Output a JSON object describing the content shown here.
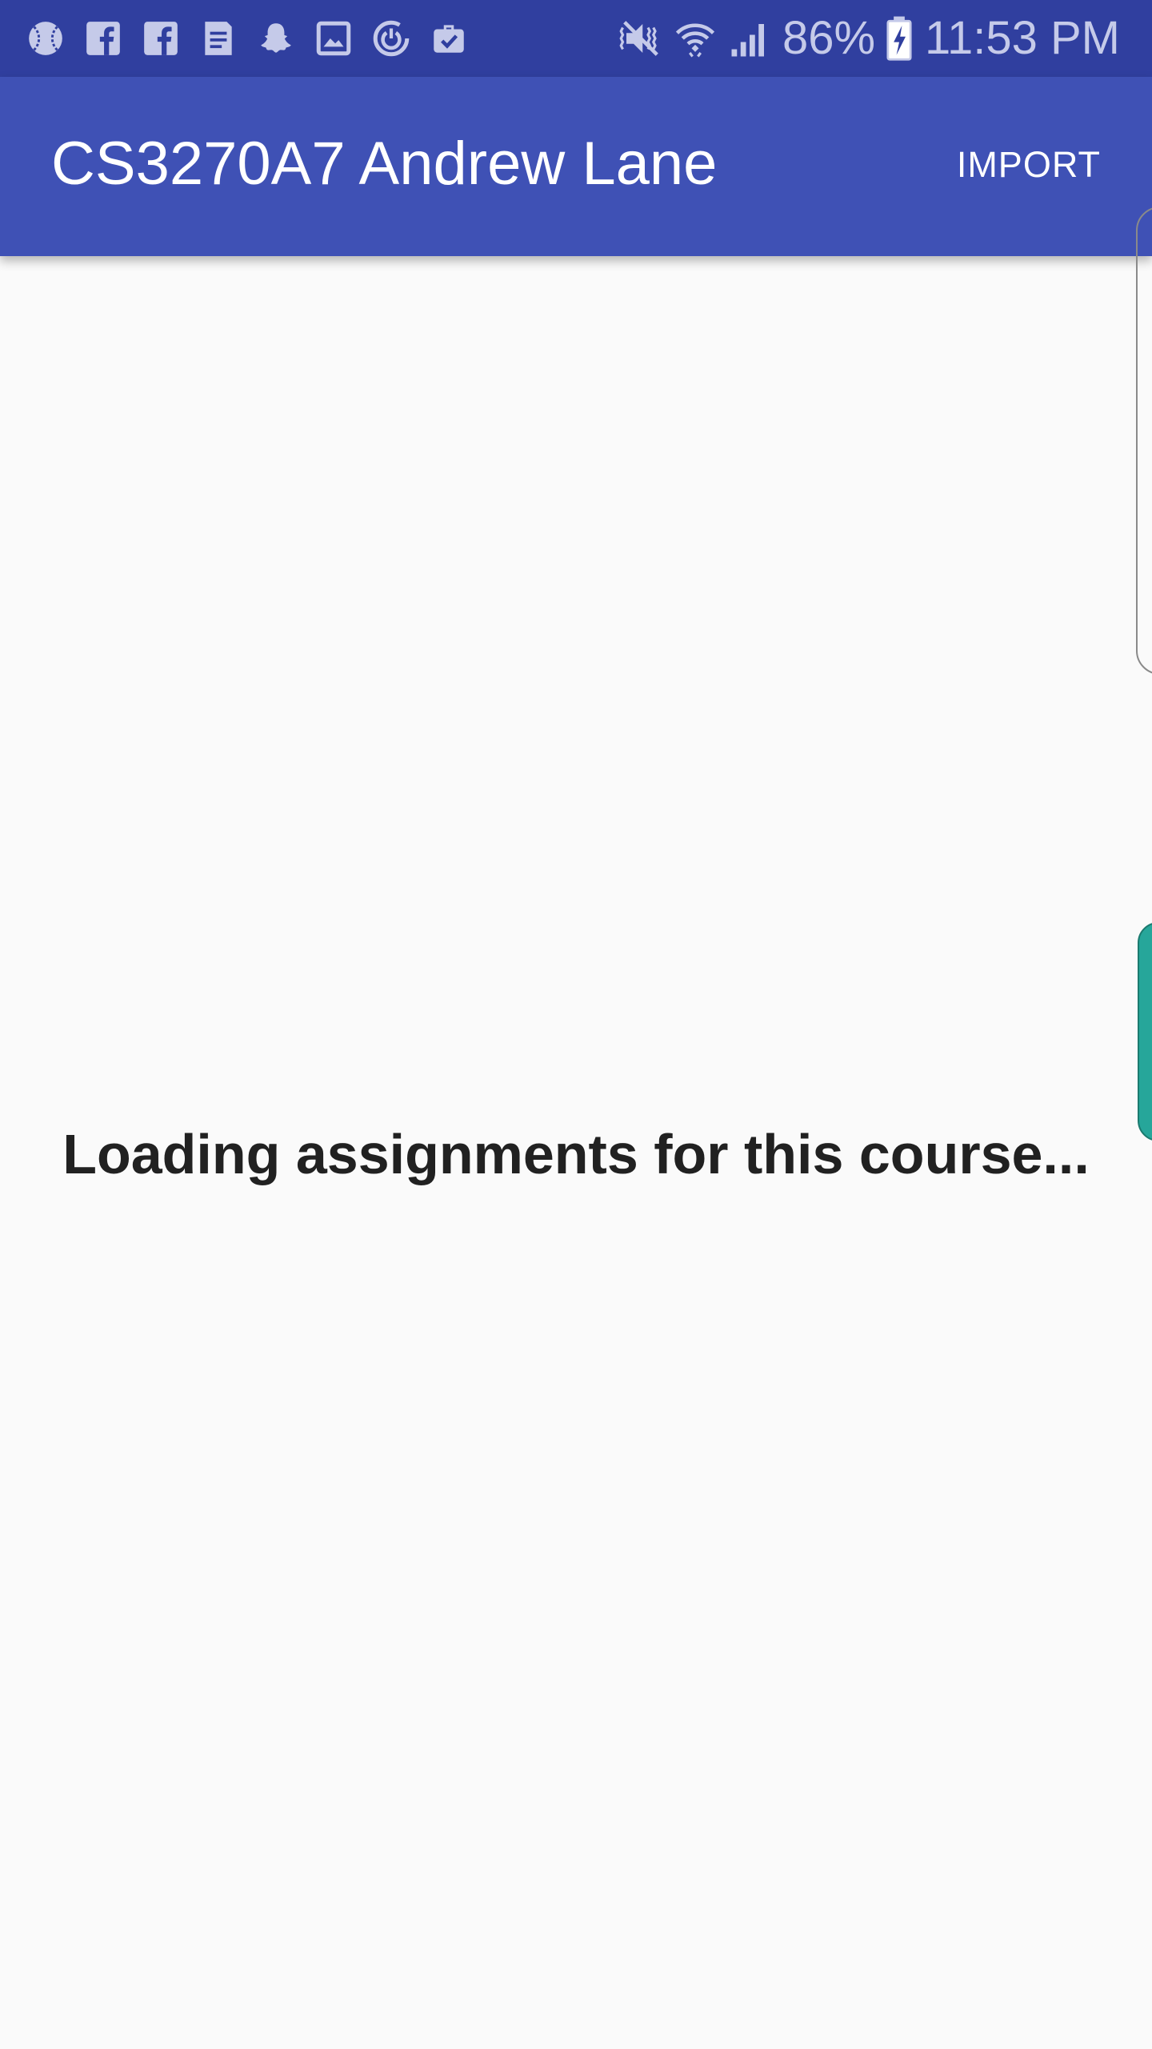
{
  "status_bar": {
    "battery_percent": "86%",
    "time": "11:53 PM",
    "notification_icons": [
      "baseball-icon",
      "facebook-icon",
      "facebook-icon",
      "news-icon",
      "snapchat-icon",
      "gallery-icon",
      "sync-icon",
      "briefcase-icon"
    ],
    "system_icons": [
      "vibrate-icon",
      "wifi-icon",
      "cell-signal-icon",
      "battery-charging-icon"
    ]
  },
  "app_bar": {
    "title": "CS3270A7 Andrew Lane",
    "import_label": "IMPORT",
    "background_color": "#3f51b5"
  },
  "main": {
    "loading_message": "Loading assignments for this course..."
  },
  "edge_panels": {
    "teal_handle_color": "#26a69a"
  }
}
